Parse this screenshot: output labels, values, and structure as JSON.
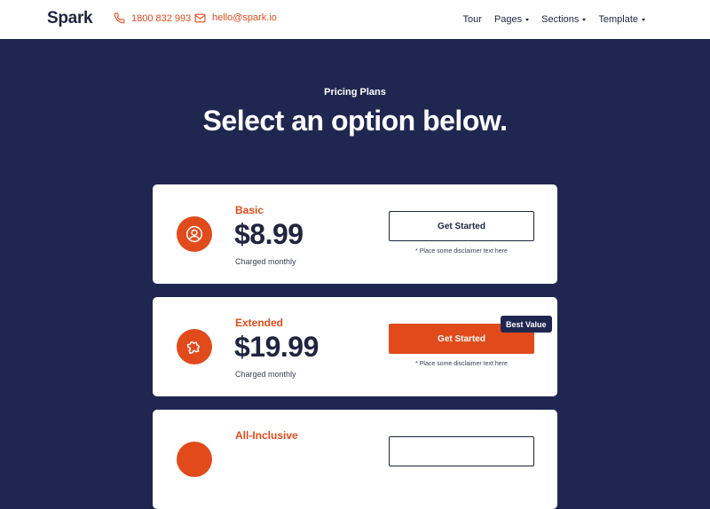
{
  "nav": {
    "brand": "Spark",
    "phone": "1800 832 993",
    "email": "hello@spark.io",
    "links": [
      {
        "label": "Tour",
        "dropdown": false
      },
      {
        "label": "Pages",
        "dropdown": true
      },
      {
        "label": "Sections",
        "dropdown": true
      },
      {
        "label": "Template",
        "dropdown": true
      }
    ]
  },
  "hero": {
    "eyebrow": "Pricing Plans",
    "headline": "Select an option below."
  },
  "plans": [
    {
      "name": "Basic",
      "price": "$8.99",
      "billing": "Charged monthly",
      "cta": "Get Started",
      "disclaimer": "* Place some disclaimer text here",
      "icon": "user-icon"
    },
    {
      "name": "Extended",
      "price": "$19.99",
      "billing": "Charged monthly",
      "cta": "Get Started",
      "disclaimer": "* Place some disclaimer text here",
      "badge": "Best Value",
      "icon": "puzzle-icon"
    },
    {
      "name": "All-Inclusive",
      "icon": "circle-icon"
    }
  ],
  "colors": {
    "accent": "#e14b1b",
    "navy": "#1f2750",
    "text": "#1f2440"
  }
}
